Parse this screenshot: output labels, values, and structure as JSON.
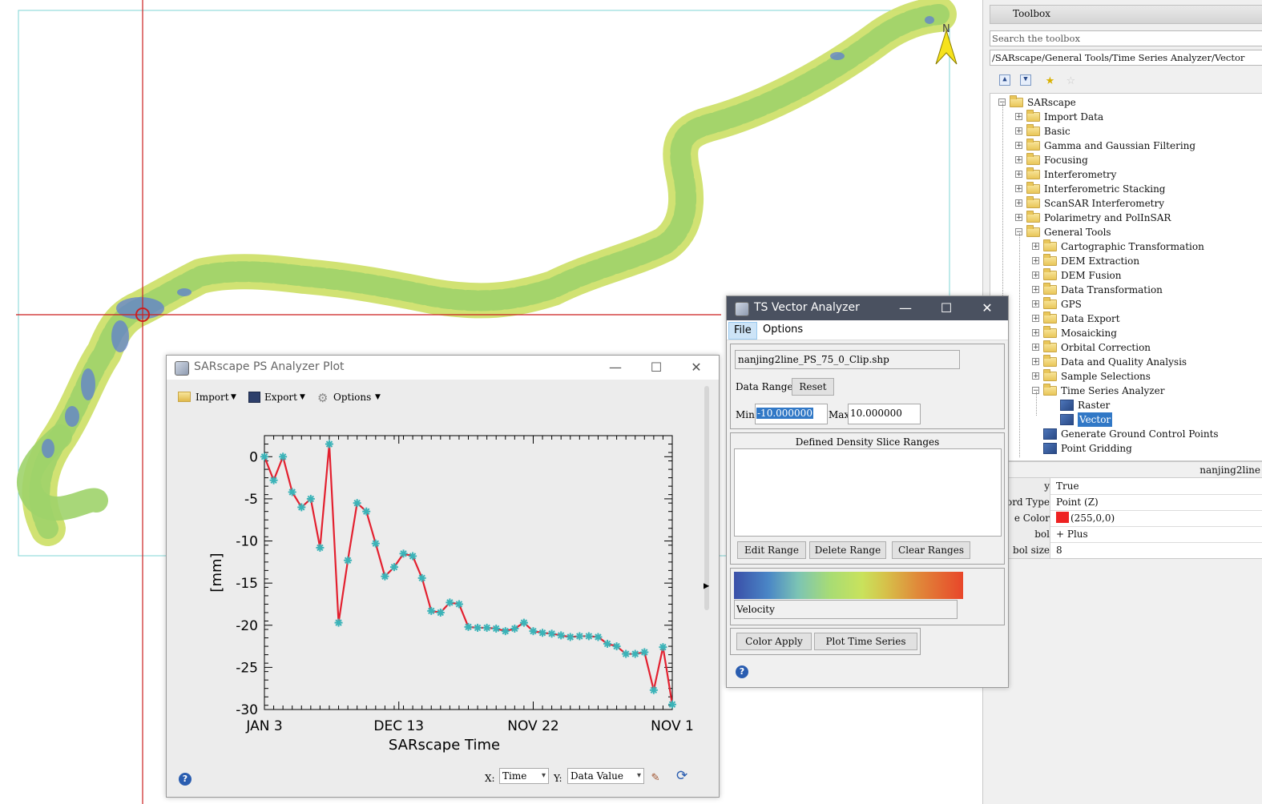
{
  "map": {
    "north_label": "N",
    "colors": {
      "high": "#5e7fd0",
      "mid": "#9fd36a",
      "low": "#cfe06c",
      "crosshair": "#cc1f1f",
      "frame": "#7fd4d4"
    }
  },
  "toolbox": {
    "title": "Toolbox",
    "search_placeholder": "Search the toolbox",
    "path": "/SARscape/General Tools/Time Series Analyzer/Vector",
    "tree": [
      {
        "label": "SARscape",
        "level": 0,
        "expanded": true
      },
      {
        "label": "Import Data",
        "level": 1
      },
      {
        "label": "Basic",
        "level": 1
      },
      {
        "label": "Gamma and Gaussian Filtering",
        "level": 1
      },
      {
        "label": "Focusing",
        "level": 1
      },
      {
        "label": "Interferometry",
        "level": 1
      },
      {
        "label": "Interferometric Stacking",
        "level": 1
      },
      {
        "label": "ScanSAR Interferometry",
        "level": 1
      },
      {
        "label": "Polarimetry and PolInSAR",
        "level": 1
      },
      {
        "label": "General Tools",
        "level": 1,
        "expanded": true
      },
      {
        "label": "Cartographic Transformation",
        "level": 2
      },
      {
        "label": "DEM Extraction",
        "level": 2
      },
      {
        "label": "DEM Fusion",
        "level": 2
      },
      {
        "label": "Data Transformation",
        "level": 2
      },
      {
        "label": "GPS",
        "level": 2
      },
      {
        "label": "Data Export",
        "level": 2
      },
      {
        "label": "Mosaicking",
        "level": 2
      },
      {
        "label": "Orbital Correction",
        "level": 2
      },
      {
        "label": "Data and Quality Analysis",
        "level": 2
      },
      {
        "label": "Sample Selections",
        "level": 2
      },
      {
        "label": "Time Series Analyzer",
        "level": 2,
        "expanded": true
      },
      {
        "label": "Raster",
        "level": 3,
        "tool": true
      },
      {
        "label": "Vector",
        "level": 3,
        "tool": true,
        "selected": true
      },
      {
        "label": "Generate Ground Control Points",
        "level": 2,
        "tool": true
      },
      {
        "label": "Point Gridding",
        "level": 2,
        "tool": true
      }
    ],
    "props_header": "nanjing2line",
    "props": [
      {
        "key": "y",
        "value": "True"
      },
      {
        "key": "ord Type",
        "value": "Point (Z)"
      },
      {
        "key": "e Color",
        "value": "(255,0,0)",
        "swatch": "#ee2222"
      },
      {
        "key": "bol",
        "value": "+ Plus"
      },
      {
        "key": "bol size",
        "value": "8"
      }
    ]
  },
  "ts_window": {
    "title": "TS Vector Analyzer",
    "menu": [
      "File",
      "Options"
    ],
    "filename": "nanjing2line_PS_75_0_Clip.shp",
    "data_range_label": "Data Range",
    "reset_label": "Reset",
    "min_label": "Min",
    "min_value": "-10.000000",
    "max_label": "Max",
    "max_value": "10.000000",
    "density_title": "Defined Density Slice Ranges",
    "edit_range": "Edit Range",
    "delete_range": "Delete Range",
    "clear_ranges": "Clear Ranges",
    "colorbar_label": "Velocity",
    "color_apply": "Color Apply",
    "plot_ts": "Plot Time Series",
    "help": "?"
  },
  "ps_window": {
    "title": "SARscape PS Analyzer Plot",
    "menu": [
      "Import",
      "Export",
      "Options"
    ],
    "x_label": "X:",
    "x_value": "Time",
    "y_label": "Y:",
    "y_value": "Data Value",
    "help": "?"
  },
  "chart_data": {
    "type": "line",
    "title": "",
    "xlabel": "SARscape Time",
    "ylabel": "[mm]",
    "x_tick_labels": [
      "JAN 3",
      "DEC 13",
      "NOV 22",
      "NOV 1"
    ],
    "y_ticks": [
      0,
      -5,
      -10,
      -15,
      -20,
      -25,
      -30
    ],
    "ylim": [
      -30,
      2.5
    ],
    "x_index_range": [
      0,
      44
    ],
    "x_tick_positions": [
      0,
      14.5,
      29,
      44
    ],
    "series": [
      {
        "values": [
          0,
          -2.8,
          0,
          -4.2,
          -6,
          -5,
          -10.8,
          1.5,
          -19.7,
          -12.3,
          -5.5,
          -6.5,
          -10.3,
          -14.2,
          -13.1,
          -11.5,
          -11.8,
          -14.4,
          -18.3,
          -18.5,
          -17.3,
          -17.5,
          -20.2,
          -20.3,
          -20.3,
          -20.4,
          -20.7,
          -20.4,
          -19.7,
          -20.7,
          -20.9,
          -21,
          -21.2,
          -21.4,
          -21.3,
          -21.3,
          -21.4,
          -22.2,
          -22.5,
          -23.4,
          -23.4,
          -23.2,
          -27.7,
          -22.6,
          -29.4
        ]
      }
    ],
    "colors": {
      "line": "#e3202f",
      "marker": "#3bb3b8"
    }
  }
}
